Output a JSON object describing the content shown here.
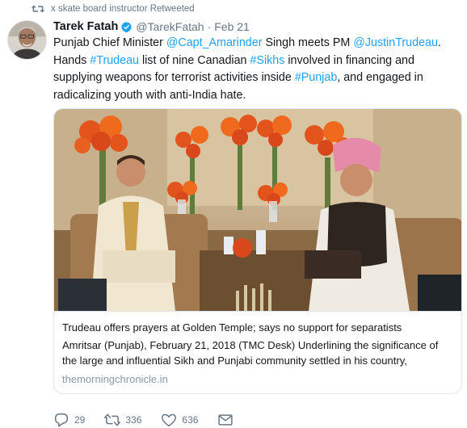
{
  "retweet_context": {
    "text": "x skate board instructor Retweeted"
  },
  "tweet": {
    "author_name": "Tarek Fatah",
    "handle": "@TarekFatah",
    "separator": "·",
    "date": "Feb 21",
    "text": {
      "t1": "Punjab Chief Minister ",
      "l1": "@Capt_Amarinder",
      "t2": " Singh meets PM ",
      "l2": "@JustinTrudeau",
      "t3": ". Hands ",
      "l3": "#Trudeau",
      "t4": " list of nine Canadian ",
      "l4": "#Sikhs",
      "t5": " involved in financing and supplying weapons for terrorist activities inside ",
      "l5": "#Punjab",
      "t6": ", and engaged in radicalizing youth with anti-India hate."
    }
  },
  "card": {
    "title": "Trudeau offers prayers at Golden Temple; says no support for separatists",
    "description": "Amritsar (Punjab), February 21, 2018 (TMC Desk) Underlining the significance of the large and influential Sikh and Punjabi community settled in his country,",
    "domain": "themorningchronicle.in"
  },
  "actions": {
    "reply_count": "29",
    "retweet_count": "336",
    "like_count": "636"
  },
  "icons": {
    "retweet_context": "retweet-icon",
    "verified": "verified-badge-icon",
    "reply": "reply-icon",
    "retweet": "retweet-icon",
    "like": "heart-icon",
    "dm": "envelope-icon"
  },
  "colors": {
    "link": "#1da1f2",
    "secondary_text": "#657786",
    "domain_text": "#8899a6",
    "border": "#e1e8ed",
    "verified": "#1da1f2"
  }
}
